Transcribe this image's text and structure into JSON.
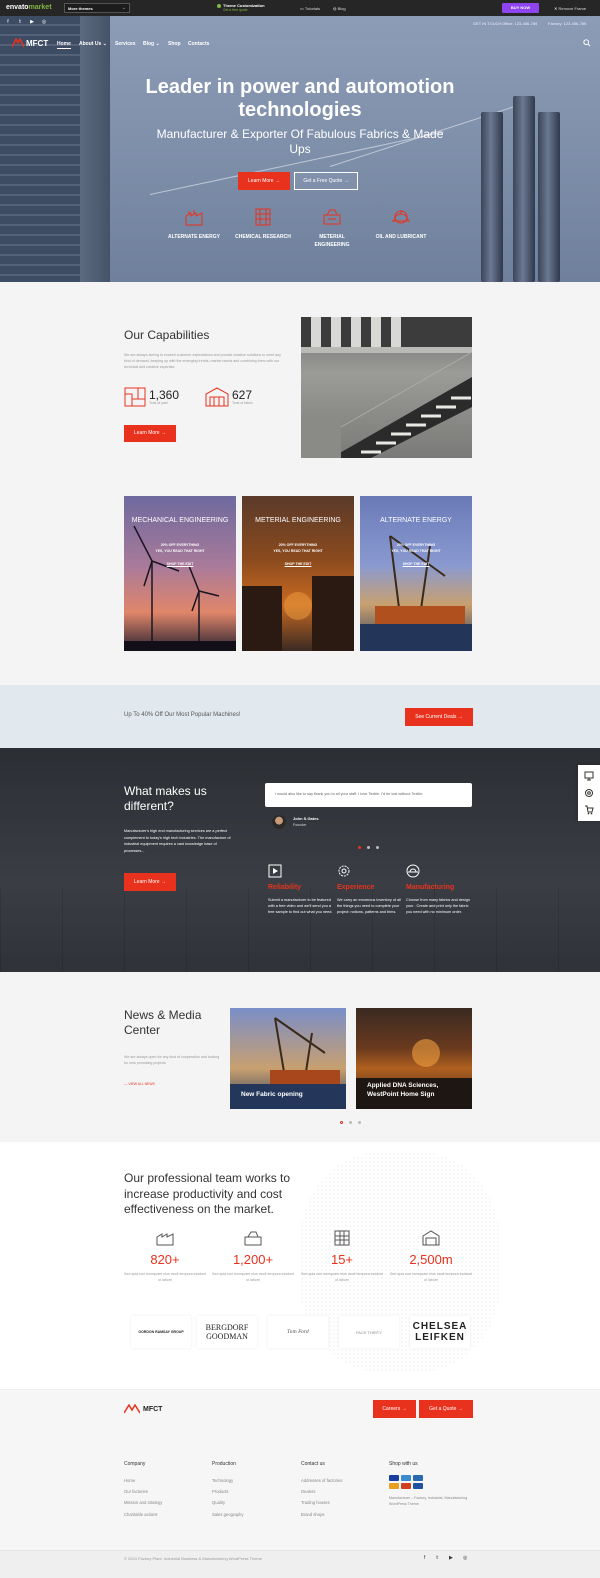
{
  "envato": {
    "logo_main": "envato",
    "logo_accent": "market",
    "theme_select": "More themes",
    "customization": "Theme Customization",
    "customization_sub": "Get a free quote",
    "tutorials": "Tutorials",
    "blog": "Blog",
    "buy_now": "BUY NOW",
    "remove_frame": "Remove Frame"
  },
  "topbar": {
    "get_in_touch": "GET IN TOUCH",
    "office": "Office: 123-456-789",
    "factory": "Factory: 123-456-789"
  },
  "nav": {
    "logo": "MFCT",
    "items": [
      "Home",
      "About Us",
      "Services",
      "Blog",
      "Shop",
      "Contacts"
    ]
  },
  "hero": {
    "title": "Leader in power and automotion technologies",
    "subtitle": "Manufacturer & Exporter Of Fabulous Fabrics & Made Ups",
    "learn_more": "Learn More",
    "free_quote": "Get a Free Quote",
    "features": [
      "ALTERNATE ENERGY",
      "CHEMICAL RESEARCH",
      "METERIAL ENGINEERING",
      "OIL AND LUBRICANT"
    ]
  },
  "capabilities": {
    "title": "Our Capabilities",
    "text": "We are always aiming to exceed customer expectations and provide creative solutions to meet any kind of demand, keeping up with the emerging trends, market needs and combining them with our technical and creative expertise.",
    "stat1_num": "1,360",
    "stat1_label": "Tons of yarn",
    "stat2_num": "627",
    "stat2_label": "Tons of fabric",
    "button": "Learn More"
  },
  "cards": [
    {
      "title": "MECHANICAL ENGINEERING",
      "sale": "20% OFF EVERYTHING",
      "sub": "YES, YOU READ THAT RIGHT",
      "link": "SHOP THE EDIT"
    },
    {
      "title": "METERIAL ENGINEERING",
      "sale": "20% OFF EVERYTHING",
      "sub": "YES, YOU READ THAT RIGHT",
      "link": "SHOP THE EDIT"
    },
    {
      "title": "ALTERNATE ENERGY",
      "sale": "20% OFF EVERYTHING",
      "sub": "YES, YOU READ THAT RIGHT",
      "link": "SHOP THE EDIT"
    }
  ],
  "promo": {
    "text": "Up To 40% Off Our Most Popular Machines!",
    "button": "See Current Deals"
  },
  "different": {
    "title": "What makes us different?",
    "text": "Manufacturer's high end manufacturing services are a perfect complement to today's high tech industries. The manufacture of industrial equipment requires a vast knowledge base of processes...",
    "button": "Learn More",
    "quote": "I would also like to say thank you to all your staff. I love Textile. I'd be lost without Textile.",
    "author": "John S.Gates",
    "role": "Founder",
    "features": [
      {
        "title": "Reliability",
        "text": "Submit a manufacturer to be featured with a free video and we'll send you a free sample to find out what you need."
      },
      {
        "title": "Experience",
        "text": "We carry an enormous inventory of all the things you need to complete your project: notions, patterns and trims."
      },
      {
        "title": "Manufacturing",
        "text": "Choose from many fabrics and design your . Create and print only the fabric you need with no minimum order."
      }
    ]
  },
  "news": {
    "title": "News & Media Center",
    "text": "We are always open for any kind of cooperation and looking for new promising projects",
    "link": "VIEW ALL NEWS",
    "items": [
      "New Fabric opening",
      "Applied DNA Sciences, WestPoint Home Sign"
    ]
  },
  "team": {
    "title": "Our professional team works to increase productivity and cost effectiveness on the market.",
    "stats": [
      {
        "num": "820+",
        "text": "Sed quia non numquam eius modi tempora incidunt ut labore"
      },
      {
        "num": "1,200+",
        "text": "Sed quia non numquam eius modi tempora incidunt ut labore"
      },
      {
        "num": "15+",
        "text": "Sed quia non numquam eius modi tempora incidunt ut labore"
      },
      {
        "num": "2,500m",
        "text": "Sed quia non numquam eius modi tempora incidunt ut labore"
      }
    ],
    "brands": [
      "GORDON RAMSAY GROUP",
      "BERGDORF GOODMAN",
      "Tom Ford",
      "FACE THIRTY",
      "CHELSEA LEIFKEN"
    ]
  },
  "footer": {
    "logo": "MFCT",
    "careers": "Careers",
    "get_quote": "Get a Quote",
    "company_title": "Company",
    "company": [
      "Home",
      "Our factories",
      "Mission and strategy",
      "Charitable actions"
    ],
    "production_title": "Production",
    "production": [
      "Technology",
      "Products",
      "Quality",
      "Sales geography"
    ],
    "contact_title": "Contact us",
    "contact": [
      "Addresses of factories",
      "Dealers",
      "Trading houses",
      "Brand shops"
    ],
    "shop_title": "Shop with us",
    "shop_text": "Manufacturer – Factory, Industrial, Manufacturing WordPress Theme",
    "copyright": "© 2024 Factory Plant, Industrial Business & Manufacturing WordPress Theme"
  },
  "colors": {
    "accent": "#e8321e",
    "dark": "#2f3338",
    "promo_bg": "#e2e9ee"
  }
}
